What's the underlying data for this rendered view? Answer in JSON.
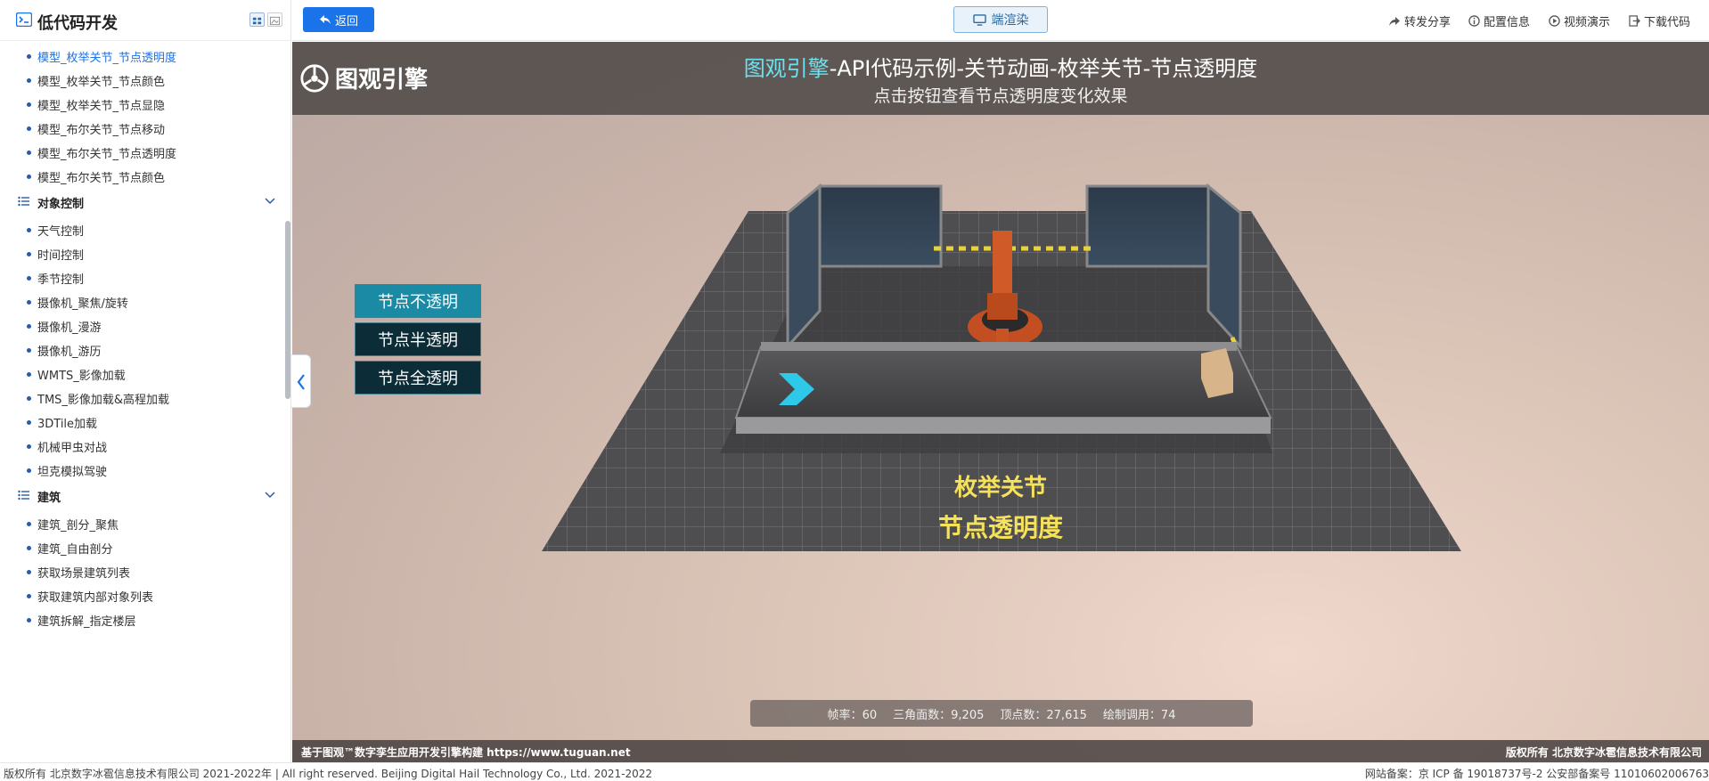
{
  "sidebar": {
    "title": "低代码开发",
    "items": [
      {
        "label": "模型_枚举关节_节点透明度",
        "active": true
      },
      {
        "label": "模型_枚举关节_节点颜色"
      },
      {
        "label": "模型_枚举关节_节点显隐"
      },
      {
        "label": "模型_布尔关节_节点移动"
      },
      {
        "label": "模型_布尔关节_节点透明度"
      },
      {
        "label": "模型_布尔关节_节点颜色"
      }
    ],
    "groups": [
      {
        "label": "对象控制",
        "items": [
          "天气控制",
          "时间控制",
          "季节控制",
          "摄像机_聚焦/旋转",
          "摄像机_漫游",
          "摄像机_游历",
          "WMTS_影像加载",
          "TMS_影像加载&高程加载",
          "3DTile加载",
          "机械甲虫对战",
          "坦克模拟驾驶"
        ]
      },
      {
        "label": "建筑",
        "items": [
          "建筑_剖分_聚焦",
          "建筑_自由剖分",
          "获取场景建筑列表",
          "获取建筑内部对象列表",
          "建筑拆解_指定楼层"
        ]
      }
    ]
  },
  "topbar": {
    "back_label": "返回",
    "render_label": "端渲染",
    "actions": [
      "转发分享",
      "配置信息",
      "视频演示",
      "下载代码"
    ]
  },
  "viewport": {
    "brand_logo_text": "图观引擎",
    "title_brand": "图观引擎",
    "title_rest": "-API代码示例-关节动画-枚举关节-节点透明度",
    "subtitle": "点击按钮查看节点透明度变化效果",
    "buttons": [
      "节点不透明",
      "节点半透明",
      "节点全透明"
    ],
    "scene_label_line1": "枚举关节",
    "scene_label_line2": "节点透明度",
    "stats": [
      {
        "label": "帧率",
        "value": "60"
      },
      {
        "label": "三角面数",
        "value": "9,205"
      },
      {
        "label": "顶点数",
        "value": "27,615"
      },
      {
        "label": "绘制调用",
        "value": "74"
      }
    ],
    "footer_left": "基于图观™数字孪生应用开发引擎构建 https://www.tuguan.net",
    "footer_right": "版权所有 北京数字冰雹信息技术有限公司"
  },
  "page_footer": {
    "left": "版权所有 北京数字冰雹信息技术有限公司 2021-2022年 | All right reserved. Beijing Digital Hail Technology Co., Ltd. 2021-2022",
    "right": "网站备案：京 ICP 备 19018737号-2 公安部备案号 11010602006763"
  },
  "colors": {
    "primary": "#1a73e8",
    "title_brand": "#6de0f0",
    "scene_label": "#f5e15a",
    "btn_active": "#1a8aa5",
    "btn_idle": "#0c2c38"
  }
}
